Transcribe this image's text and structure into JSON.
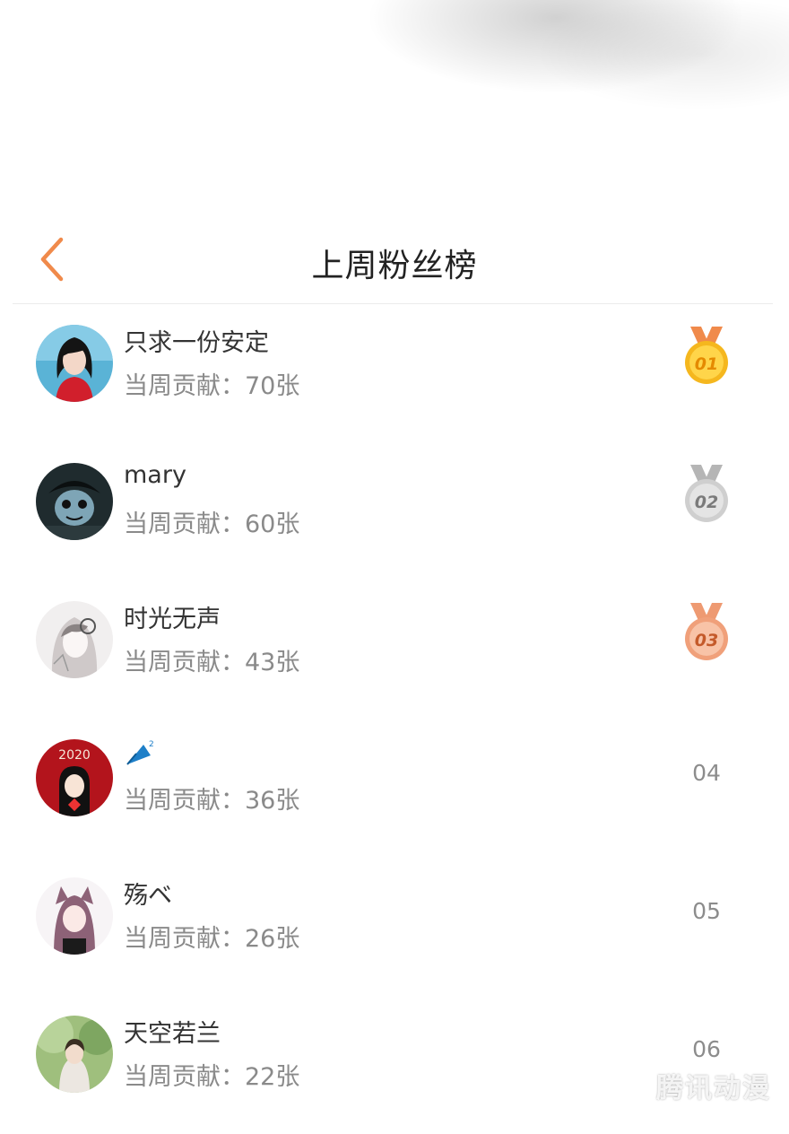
{
  "header": {
    "title": "上周粉丝榜",
    "back_icon": "chevron-left-icon",
    "accent_color": "#f08a4b"
  },
  "list": [
    {
      "name": "只求一份安定",
      "contribution": "当周贡献：70张",
      "rank": "01",
      "medal": "gold",
      "avatar": "avatar-woman-red"
    },
    {
      "name": "mary",
      "contribution": "当周贡献：60张",
      "rank": "02",
      "medal": "silver",
      "avatar": "avatar-dark-character"
    },
    {
      "name": "时光无声",
      "contribution": "当周贡献：43张",
      "rank": "03",
      "medal": "bronze",
      "avatar": "avatar-sketch-girl"
    },
    {
      "name": "",
      "contribution": "当周贡献：36张",
      "rank": "04",
      "medal": "",
      "avatar": "avatar-2020-girl",
      "name_icon": "umbrella-icon"
    },
    {
      "name": "殇ベ",
      "contribution": "当周贡献：26张",
      "rank": "05",
      "medal": "",
      "avatar": "avatar-catgirl"
    },
    {
      "name": "天空若兰",
      "contribution": "当周贡献：22张",
      "rank": "06",
      "medal": "",
      "avatar": "avatar-nature-girl"
    }
  ],
  "medal_colors": {
    "gold": "#f5b71e",
    "silver": "#c8c8c8",
    "bronze": "#f0a07a",
    "ribbon": "#f08a4b"
  },
  "watermark": "腾讯动漫"
}
